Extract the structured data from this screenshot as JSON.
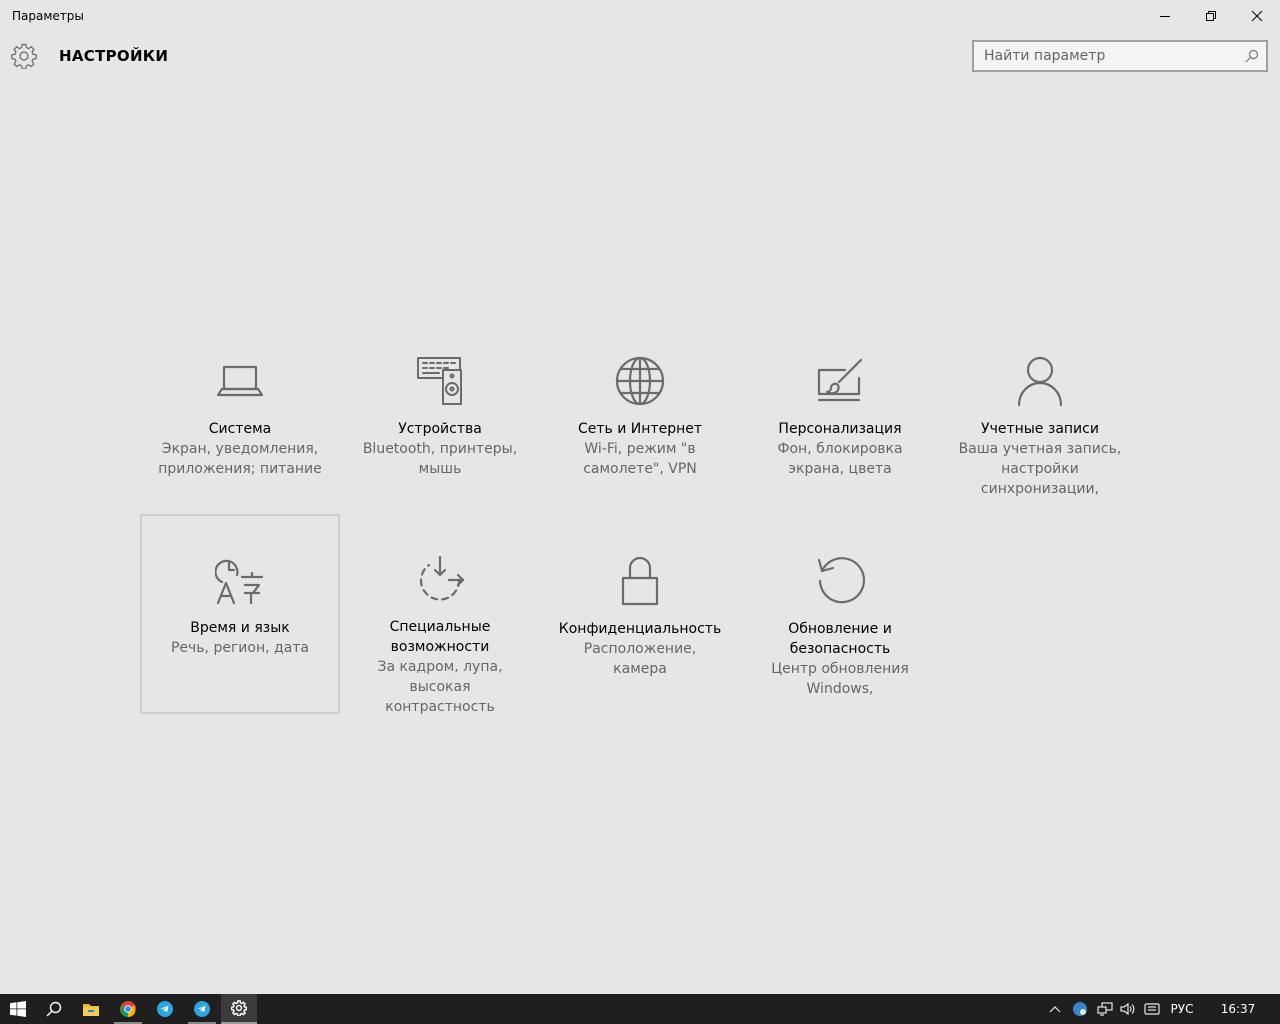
{
  "window": {
    "title": "Параметры",
    "controls": {
      "minimize": "minimize",
      "restore": "restore",
      "close": "close"
    }
  },
  "header": {
    "title": "НАСТРОЙКИ",
    "icon": "gear-icon"
  },
  "search": {
    "placeholder": "Найти параметр",
    "value": "",
    "icon": "search-icon"
  },
  "categories": [
    {
      "id": "system",
      "icon": "laptop-icon",
      "name": "Система",
      "desc": "Экран, уведомления, приложения; питание"
    },
    {
      "id": "devices",
      "icon": "devices-icon",
      "name": "Устройства",
      "desc": "Bluetooth, принтеры, мышь"
    },
    {
      "id": "network",
      "icon": "globe-icon",
      "name": "Сеть и Интернет",
      "desc": "Wi-Fi, режим \"в самолете\", VPN"
    },
    {
      "id": "personalization",
      "icon": "paint-icon",
      "name": "Персонализация",
      "desc": "Фон, блокировка экрана, цвета"
    },
    {
      "id": "accounts",
      "icon": "person-icon",
      "name": "Учетные записи",
      "desc": "Ваша учетная запись, настройки синхронизации,"
    },
    {
      "id": "time-language",
      "icon": "time-language-icon",
      "name": "Время и язык",
      "desc": "Речь, регион, дата",
      "selected": true
    },
    {
      "id": "ease-of-access",
      "icon": "ease-of-access-icon",
      "name": "Специальные возможности",
      "desc": "За кадром, лупа, высокая контрастность"
    },
    {
      "id": "privacy",
      "icon": "lock-icon",
      "name": "Конфиденциальность",
      "desc": "Расположение, камера"
    },
    {
      "id": "update-security",
      "icon": "refresh-icon",
      "name": "Обновление и безопасность",
      "desc": "Центр обновления Windows,"
    }
  ],
  "taskbar": {
    "items": [
      "windows-start-icon",
      "search-icon",
      "file-explorer-icon",
      "chrome-icon",
      "telegram-icon",
      "telegram-icon",
      "settings-icon"
    ],
    "tray": {
      "language": "РУС",
      "time": "16:37"
    },
    "colors": {
      "background": "#1f1f1f",
      "telegram": "#2ca5e0"
    }
  }
}
